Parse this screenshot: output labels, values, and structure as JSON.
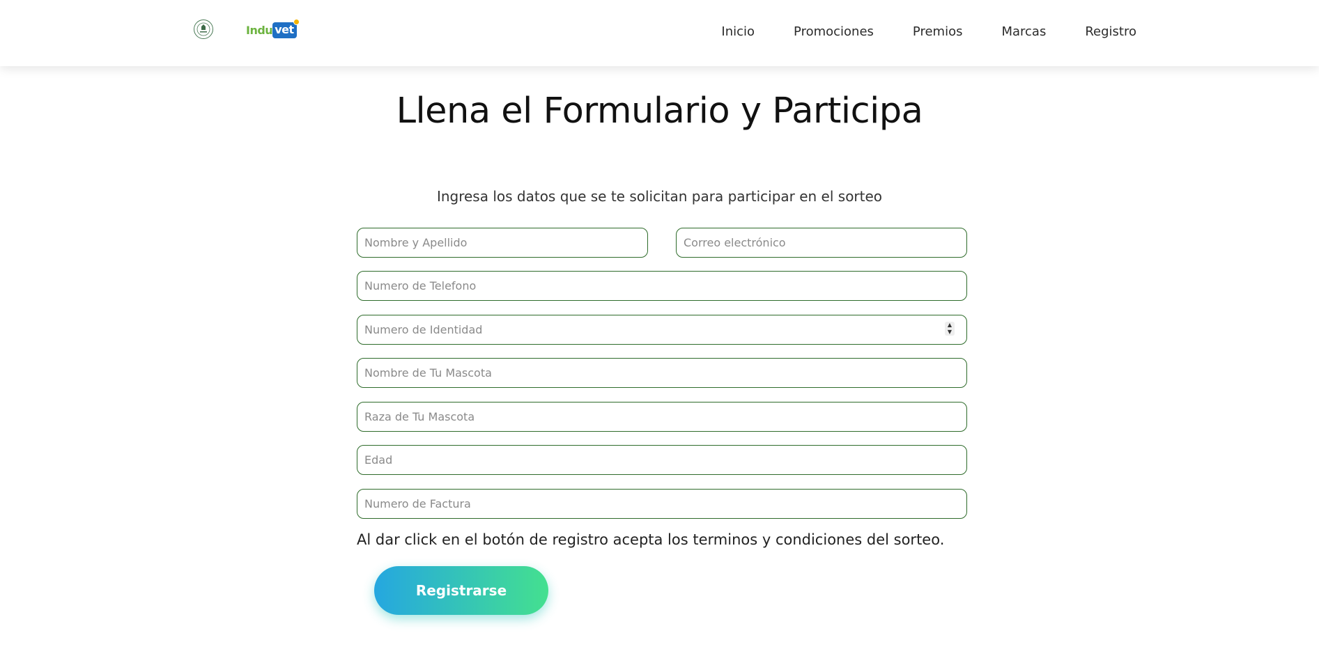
{
  "header": {
    "brand_text": "Induvet",
    "brand_part1": "Indu",
    "brand_part2": "vet",
    "nav": [
      "Inicio",
      "Promociones",
      "Premios",
      "Marcas",
      "Registro"
    ]
  },
  "main": {
    "title": "Llena el Formulario y Participa",
    "subtitle": "Ingresa los datos que se te solicitan para participar en el sorteo",
    "fields": {
      "name": {
        "placeholder": "Nombre y Apellido",
        "value": ""
      },
      "email": {
        "placeholder": "Correo electrónico",
        "value": ""
      },
      "phone": {
        "placeholder": "Numero de Telefono",
        "value": ""
      },
      "id_number": {
        "placeholder": "Numero de Identidad",
        "value": ""
      },
      "pet_name": {
        "placeholder": "Nombre de Tu Mascota",
        "value": ""
      },
      "pet_breed": {
        "placeholder": "Raza de Tu Mascota",
        "value": ""
      },
      "age": {
        "placeholder": "Edad",
        "value": ""
      },
      "invoice": {
        "placeholder": "Numero de Factura",
        "value": ""
      }
    },
    "terms_text": "Al dar click en el botón de registro acepta los terminos y condiciones del sorteo.",
    "submit_label": "Registrarse"
  },
  "colors": {
    "field_border": "#2e6b2a",
    "button_gradient_start": "#25a7e0",
    "button_gradient_end": "#44e08f",
    "brand_green": "#6cb33f",
    "brand_blue": "#1f6fc4"
  }
}
